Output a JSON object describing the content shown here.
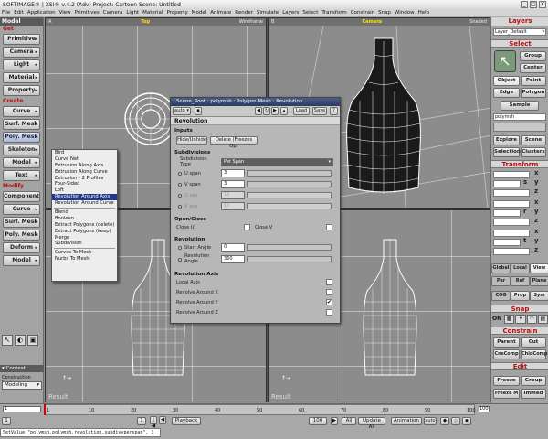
{
  "window": {
    "title": "SOFTIMAGE® | XSI® v.4.2 (Adv) Project: Cartoon   Scene: Untitled"
  },
  "menu": [
    "File",
    "Edit",
    "Application",
    "View",
    "Primitives",
    "Camera",
    "Light",
    "Material",
    "Property",
    "Model",
    "Animate",
    "Render",
    "Simulate",
    "Layers",
    "Select",
    "Transform",
    "Constrain",
    "Snap",
    "Window",
    "Help"
  ],
  "left": {
    "tab": "Model",
    "get": "Get",
    "get_items": [
      "Primitive",
      "Camera",
      "Light",
      "Material",
      "Property"
    ],
    "create": "Create",
    "create_items": [
      "Curve",
      "Surf. Mesh",
      "Poly. Mesh",
      "Skeleton",
      "Model",
      "Text"
    ],
    "modify": "Modify",
    "modify_items": [
      "Component",
      "Curve",
      "Surf. Mesh",
      "Poly. Mesh",
      "Deform",
      "Model"
    ],
    "context": "▾ Context",
    "construction_label": "Construction Mode",
    "construction_value": "Modeling"
  },
  "viewports": {
    "tl": {
      "name": "Top",
      "mode": "Wireframe"
    },
    "tr": {
      "name": "Camera",
      "mode": "Shaded"
    },
    "bl": {
      "name": "Result"
    },
    "br": {
      "name": "Result"
    }
  },
  "popup": {
    "items": [
      "Bird",
      "Curve Net",
      "Extrusion Along Axis",
      "Extrusion Along Curve",
      "Extrusion - 2 Profiles",
      "Four-Sided",
      "Loft",
      "Revolution Around Axis",
      "Revolution Around Curve",
      "|",
      "Blend",
      "Boolean",
      "Extract Polygons (delete)",
      "Extract Polygons (keep)",
      "Merge",
      "Subdivision",
      "|",
      "Curves To Mesh",
      "Nurbs To Mesh"
    ],
    "highlighted": "Revolution Around Axis"
  },
  "prop": {
    "title": "Scene_Root : polymsh : Polygon Mesh : Revolution",
    "auto": "auto",
    "load": "Load",
    "save": "Save",
    "q": "?",
    "header": "Revolution",
    "inputs": "Inputs",
    "hide_unhide": "Hide/Unhide",
    "delete_freeze": "Delete (Freezes Op)",
    "subdivisions": "Subdivisions",
    "subdiv_type": "Subdivision\nType",
    "subdiv_value": "Per Span",
    "uspan": "U span",
    "uspan_val": "3",
    "vspan": "V span",
    "vspan_val": "3",
    "uabs": "U abs",
    "uabs_val": "10",
    "vabs": "V abs",
    "vabs_val": "10",
    "openclose": "Open/Close",
    "closeu": "Close U",
    "closev": "Close V",
    "revolution": "Revolution",
    "start": "Start Angle",
    "start_val": "0",
    "revangle": "Revolution\nAngle",
    "revangle_val": "360",
    "axis": "Revolution Axis",
    "local": "Local Axis",
    "aroundx": "Revolve Around X",
    "aroundy": "Revolve Around Y",
    "aroundz": "Revolve Around Z"
  },
  "right": {
    "layers": "Layers",
    "layer_default": "Layer_Default",
    "select": "Select",
    "group": "Group",
    "center": "Center",
    "object": "Object",
    "point": "Point",
    "edge": "Edge",
    "polygon": "Polygon",
    "sample": "Sample",
    "polymsh": "polymsh",
    "explore": "Explore",
    "scene": "Scene",
    "selection": "Selection",
    "clusters": "Clusters",
    "transform": "Transform",
    "s": "s",
    "r": "r",
    "t": "t",
    "x": "x",
    "y": "y",
    "z": "z",
    "global": "Global",
    "local": "Local",
    "view": "View",
    "par": "Par",
    "ref": "Ref",
    "plane": "Plane",
    "cog": "COG",
    "prop": "Prop",
    "sym": "Sym",
    "snap": "Snap",
    "on": "ON",
    "constrain": "Constrain",
    "parent": "Parent",
    "cut": "Cut",
    "cnscomp": "CnsComp",
    "chldcomp": "ChldComp",
    "edit": "Edit",
    "freeze": "Freeze",
    "group2": "Group",
    "freezem": "Freeze M",
    "immed": "Immed"
  },
  "timeline": {
    "ticks": [
      "1",
      "10",
      "20",
      "30",
      "40",
      "50",
      "60",
      "70",
      "80",
      "90",
      "100"
    ],
    "start": "1",
    "end": "100",
    "frame": "1",
    "playback": "Playback",
    "all": "All",
    "update_all": "Update All",
    "animation": "Animation",
    "auto": "auto",
    "script": "SetValue \"polymsh.polymsh.revolution.subdivvperspan\", 3"
  }
}
